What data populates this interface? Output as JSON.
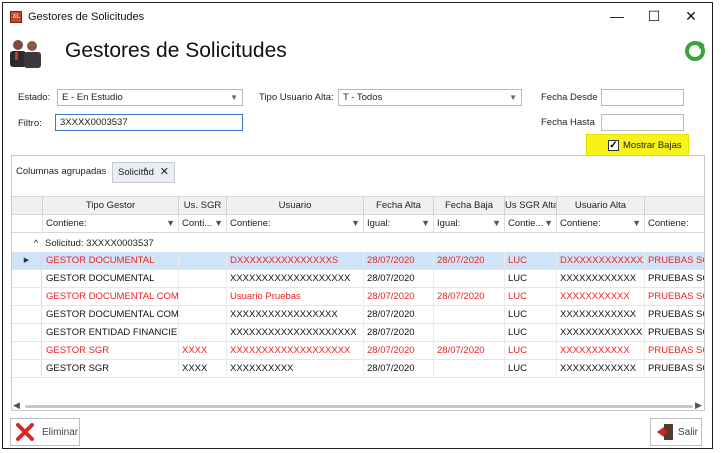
{
  "window": {
    "title": "Gestores de Solicitudes",
    "app_icon_text": "XL",
    "minimize": "—",
    "maximize": "☐",
    "close": "✕"
  },
  "header": {
    "page_title": "Gestores de Solicitudes"
  },
  "filters": {
    "estado_label": "Estado:",
    "estado_value": "E - En Estudio",
    "tipo_usuario_label": "Tipo Usuario Alta:",
    "tipo_usuario_value": "T - Todos",
    "fecha_desde_label": "Fecha Desde",
    "fecha_desde_value": "",
    "fecha_hasta_label": "Fecha Hasta",
    "fecha_hasta_value": "",
    "filtro_label": "Filtro:",
    "filtro_value": "3XXXX0003537",
    "mostrar_bajas_label": "Mostrar Bajas",
    "mostrar_bajas_checked": "✓"
  },
  "grid": {
    "grouped_label": "Columnas agrupadas",
    "group_chip": "Solicitud",
    "group_chip_close": "✕",
    "columns": [
      "Tipo Gestor",
      "Us. SGR",
      "Usuario",
      "Fecha Alta",
      "Fecha Baja",
      "Us SGR Alta",
      "Usuario Alta",
      ""
    ],
    "filters_row": [
      "Contiene:",
      "Conti...",
      "Contiene:",
      "Igual:",
      "Igual:",
      "Contie...",
      "Contiene:",
      "Contiene:"
    ],
    "group_row": "Solicitud: 3XXXX0003537",
    "rows": [
      {
        "color": "red",
        "selected": true,
        "cells": [
          "GESTOR DOCUMENTAL",
          "",
          "DXXXXXXXXXXXXXXXS",
          "28/07/2020",
          "28/07/2020",
          "LUC",
          "DXXXXXXXXXXXXX",
          "PRUEBAS SGR"
        ]
      },
      {
        "color": "blk",
        "selected": false,
        "cells": [
          "GESTOR DOCUMENTAL",
          "",
          "XXXXXXXXXXXXXXXXXXX",
          "28/07/2020",
          "",
          "LUC",
          "XXXXXXXXXXXX",
          "PRUEBAS SGR"
        ]
      },
      {
        "color": "red",
        "selected": false,
        "cells": [
          "GESTOR DOCUMENTAL COMP...",
          "",
          "Usuario Pruebas",
          "28/07/2020",
          "28/07/2020",
          "LUC",
          "XXXXXXXXXXX",
          "PRUEBAS SGR"
        ]
      },
      {
        "color": "blk",
        "selected": false,
        "cells": [
          "GESTOR DOCUMENTAL COMP...",
          "",
          "XXXXXXXXXXXXXXXXX",
          "28/07/2020",
          "",
          "LUC",
          "XXXXXXXXXXXX",
          "PRUEBAS SGR"
        ]
      },
      {
        "color": "blk",
        "selected": false,
        "cells": [
          "GESTOR ENTIDAD FINANCIERA",
          "",
          "XXXXXXXXXXXXXXXXXXXX",
          "28/07/2020",
          "",
          "LUC",
          "XXXXXXXXXXXXX",
          "PRUEBAS SGR"
        ]
      },
      {
        "color": "red",
        "selected": false,
        "cells": [
          "GESTOR SGR",
          "XXXX",
          "XXXXXXXXXXXXXXXXXXX",
          "28/07/2020",
          "28/07/2020",
          "LUC",
          "XXXXXXXXXXX",
          "PRUEBAS SGR"
        ]
      },
      {
        "color": "blk",
        "selected": false,
        "cells": [
          "GESTOR SGR",
          "XXXX",
          "XXXXXXXXXX",
          "28/07/2020",
          "",
          "LUC",
          "XXXXXXXXXXXX",
          "PRUEBAS SGR"
        ]
      }
    ],
    "row_indicator": "▶"
  },
  "footer": {
    "eliminar_label": "Eliminar",
    "salir_label": "Salir"
  },
  "colors": {
    "red_text": "#e22222",
    "selection": "#cfe4f7",
    "highlight": "#f6f21a"
  }
}
